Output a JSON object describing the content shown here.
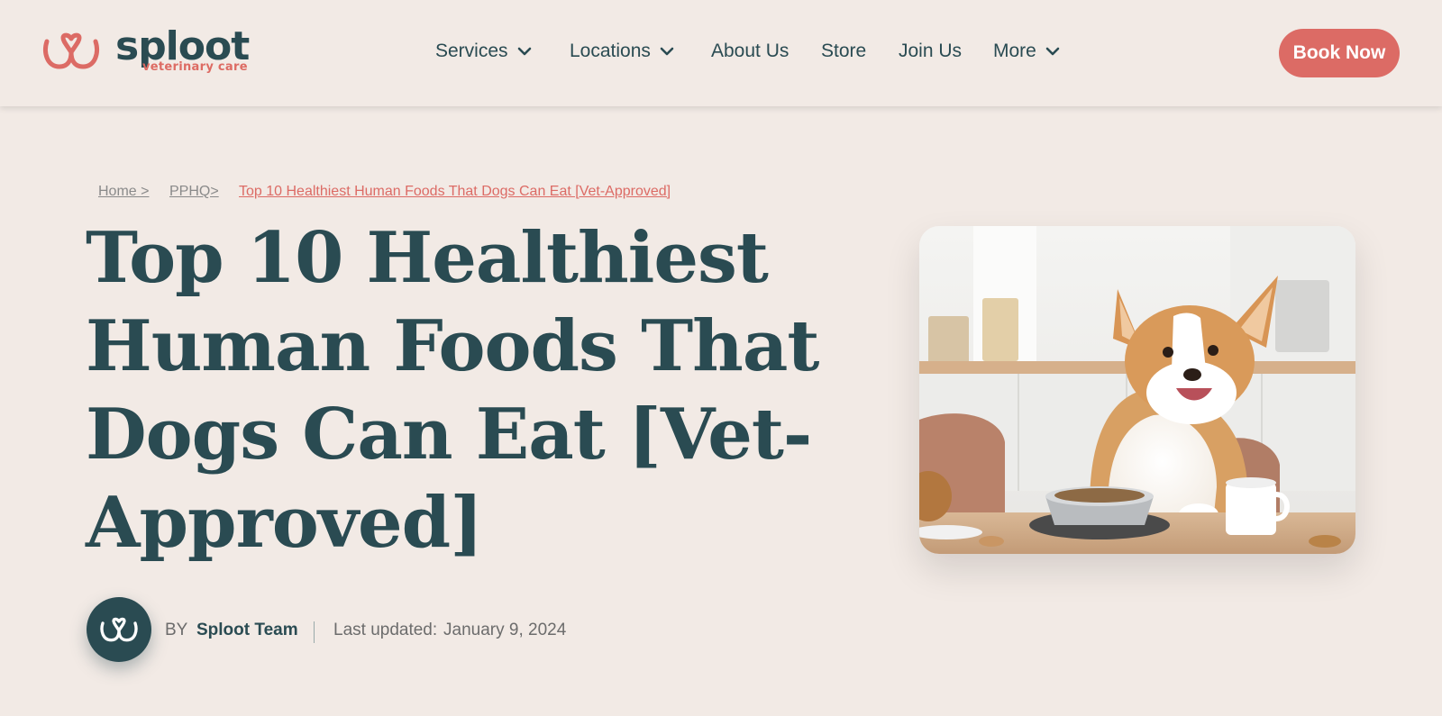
{
  "brand": {
    "name": "sploot",
    "tagline": "veterinary care",
    "accent_color": "#dc6b65",
    "primary_color": "#2a4b52",
    "background_color": "#f2eae5"
  },
  "nav": {
    "items": [
      {
        "label": "Services",
        "has_dropdown": true
      },
      {
        "label": "Locations",
        "has_dropdown": true
      },
      {
        "label": "About Us",
        "has_dropdown": false
      },
      {
        "label": "Store",
        "has_dropdown": false
      },
      {
        "label": "Join Us",
        "has_dropdown": false
      },
      {
        "label": "More",
        "has_dropdown": true
      }
    ],
    "cta_label": "Book Now"
  },
  "breadcrumb": {
    "home": "Home >",
    "section": "PPHQ>",
    "current": "Top 10 Healthiest Human Foods That Dogs Can Eat [Vet-Approved]"
  },
  "article": {
    "title": "Top 10 Healthiest Human Foods That Dogs Can Eat [Vet-Approved]",
    "by_label": "BY",
    "author": "Sploot Team",
    "updated_label": "Last updated:",
    "updated_date": "January 9, 2024"
  },
  "hero_image": {
    "icon": "corgi-photo"
  }
}
